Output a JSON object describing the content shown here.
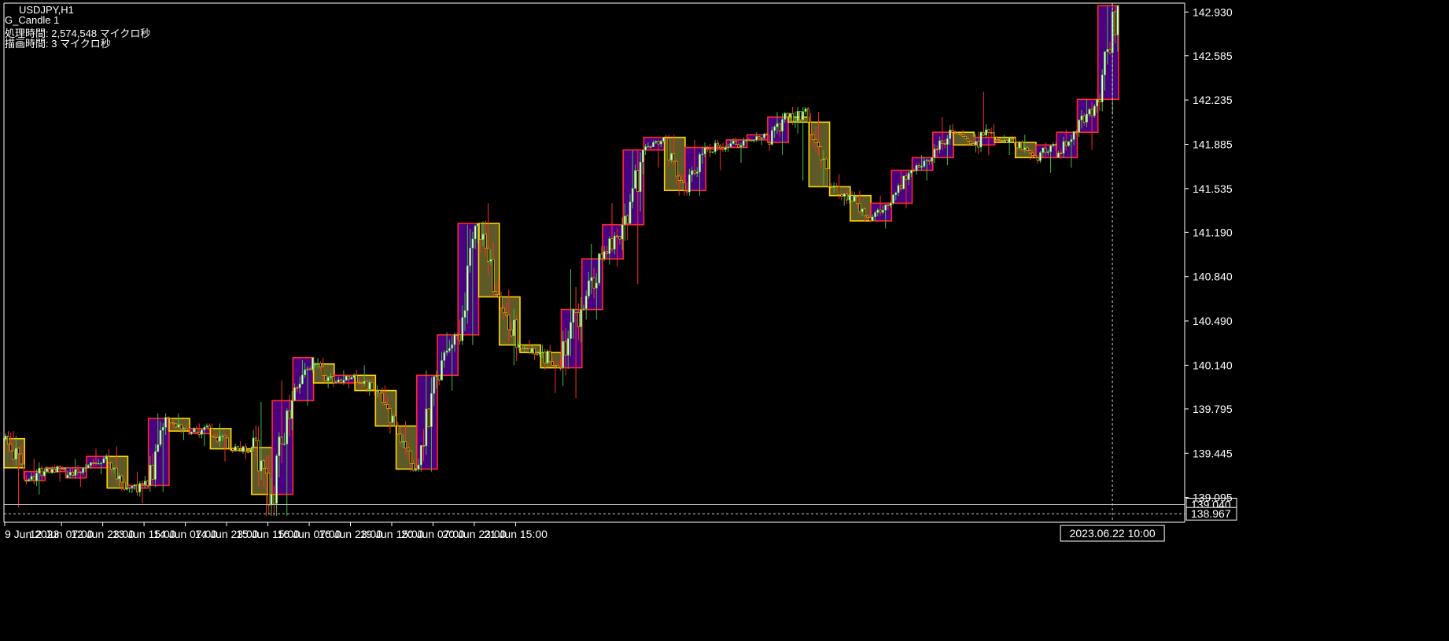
{
  "window": {
    "symbol": "USDJPY,H1",
    "indicator": "G_Candle 1",
    "info_lines": [
      "処理時間: 2,574,548 マイクロ秒",
      "描画時間: 3 マイクロ秒"
    ]
  },
  "colors": {
    "background": "#000000",
    "axis": "#ffffff",
    "bull_small_fill": "#e9ffd1",
    "bull_small_outline": "#3fbf3f",
    "bear_small_fill": "#000000",
    "bear_small_outline": "#ffd400",
    "bull_wick": "#3fbf3f",
    "bear_wick": "#ff2a2a",
    "big_bull_fill": "#4b0082",
    "big_bull_outline": "#ff2a2a",
    "big_bear_fill": "#5d5a28",
    "big_bear_outline": "#ffd400",
    "grid": "none"
  },
  "chart_data": {
    "type": "candlestick",
    "title": "USDJPY,H1",
    "timeframe_small": "H1",
    "timeframe_big": "H8",
    "ylim": [
      138.9,
      143.0
    ],
    "y_ticks": [
      "142.930",
      "142.585",
      "142.235",
      "141.885",
      "141.535",
      "141.190",
      "140.840",
      "140.490",
      "140.140",
      "139.795",
      "139.445",
      "139.095"
    ],
    "x_ticks": [
      "9 Jun 2023",
      "12 Jun 07:00",
      "12 Jun 23:00",
      "13 Jun 15:00",
      "14 Jun 07:00",
      "14 Jun 23:00",
      "15 Jun 15:00",
      "16 Jun 07:00",
      "16 Jun 23:00",
      "19 Jun 15:00",
      "20 Jun 07:00",
      "20 Jun 23:00",
      "21 Jun 15:00"
    ],
    "price_labels": [
      {
        "value": "139.040",
        "style": "dark",
        "level": 139.04
      },
      {
        "value": "138.967",
        "style": "dark",
        "level": 138.967
      }
    ],
    "crosshair": {
      "time_label": "2023.06.22 10:00",
      "bar_index": 429,
      "price": 138.967
    },
    "big_candles": [
      {
        "open": 139.56,
        "high": 139.62,
        "low": 139.02,
        "close": 139.33
      },
      {
        "open": 139.23,
        "high": 139.4,
        "low": 139.12,
        "close": 139.3
      },
      {
        "open": 139.3,
        "high": 139.35,
        "low": 139.22,
        "close": 139.33
      },
      {
        "open": 139.25,
        "high": 139.4,
        "low": 139.18,
        "close": 139.33
      },
      {
        "open": 139.33,
        "high": 139.48,
        "low": 139.28,
        "close": 139.42
      },
      {
        "open": 139.42,
        "high": 139.5,
        "low": 139.15,
        "close": 139.17
      },
      {
        "open": 139.17,
        "high": 139.3,
        "low": 139.05,
        "close": 139.19
      },
      {
        "open": 139.19,
        "high": 139.76,
        "low": 139.14,
        "close": 139.72
      },
      {
        "open": 139.72,
        "high": 139.76,
        "low": 139.55,
        "close": 139.62
      },
      {
        "open": 139.6,
        "high": 139.68,
        "low": 139.5,
        "close": 139.64
      },
      {
        "open": 139.64,
        "high": 139.68,
        "low": 139.38,
        "close": 139.48
      },
      {
        "open": 139.48,
        "high": 139.54,
        "low": 139.4,
        "close": 139.47
      },
      {
        "open": 139.49,
        "high": 139.85,
        "low": 138.95,
        "close": 139.12
      },
      {
        "open": 139.12,
        "high": 140.02,
        "low": 138.95,
        "close": 139.86
      },
      {
        "open": 139.86,
        "high": 140.18,
        "low": 139.82,
        "close": 140.2
      },
      {
        "open": 140.15,
        "high": 140.2,
        "low": 139.96,
        "close": 140.0
      },
      {
        "open": 140.0,
        "high": 140.1,
        "low": 139.96,
        "close": 140.06
      },
      {
        "open": 140.06,
        "high": 140.14,
        "low": 139.9,
        "close": 139.94
      },
      {
        "open": 139.94,
        "high": 139.98,
        "low": 139.6,
        "close": 139.66
      },
      {
        "open": 139.66,
        "high": 139.7,
        "low": 139.3,
        "close": 139.32
      },
      {
        "open": 139.32,
        "high": 140.1,
        "low": 139.3,
        "close": 140.06
      },
      {
        "open": 140.06,
        "high": 140.4,
        "low": 139.94,
        "close": 140.38
      },
      {
        "open": 140.38,
        "high": 141.25,
        "low": 140.3,
        "close": 141.26
      },
      {
        "open": 141.26,
        "high": 141.42,
        "low": 140.68,
        "close": 140.68
      },
      {
        "open": 140.68,
        "high": 140.74,
        "low": 140.14,
        "close": 140.3
      },
      {
        "open": 140.3,
        "high": 140.34,
        "low": 140.18,
        "close": 140.24
      },
      {
        "open": 140.24,
        "high": 140.3,
        "low": 139.92,
        "close": 140.12
      },
      {
        "open": 140.12,
        "high": 140.9,
        "low": 139.88,
        "close": 140.58
      },
      {
        "open": 140.58,
        "high": 141.1,
        "low": 140.5,
        "close": 140.98
      },
      {
        "open": 140.98,
        "high": 141.42,
        "low": 140.92,
        "close": 141.25
      },
      {
        "open": 141.25,
        "high": 141.84,
        "low": 140.78,
        "close": 141.84
      },
      {
        "open": 141.84,
        "high": 141.92,
        "low": 141.7,
        "close": 141.94
      },
      {
        "open": 141.94,
        "high": 141.96,
        "low": 141.48,
        "close": 141.52
      },
      {
        "open": 141.52,
        "high": 141.92,
        "low": 141.48,
        "close": 141.86
      },
      {
        "open": 141.86,
        "high": 141.92,
        "low": 141.68,
        "close": 141.86
      },
      {
        "open": 141.86,
        "high": 141.94,
        "low": 141.74,
        "close": 141.92
      },
      {
        "open": 141.92,
        "high": 141.98,
        "low": 141.88,
        "close": 141.96
      },
      {
        "open": 141.9,
        "high": 142.14,
        "low": 141.8,
        "close": 142.1
      },
      {
        "open": 142.1,
        "high": 142.18,
        "low": 141.6,
        "close": 142.06
      },
      {
        "open": 142.06,
        "high": 142.14,
        "low": 141.56,
        "close": 141.55
      },
      {
        "open": 141.55,
        "high": 141.65,
        "low": 141.4,
        "close": 141.48
      },
      {
        "open": 141.48,
        "high": 141.52,
        "low": 141.27,
        "close": 141.28
      },
      {
        "open": 141.28,
        "high": 141.48,
        "low": 141.22,
        "close": 141.42
      },
      {
        "open": 141.42,
        "high": 141.68,
        "low": 141.38,
        "close": 141.68
      },
      {
        "open": 141.68,
        "high": 141.8,
        "low": 141.6,
        "close": 141.78
      },
      {
        "open": 141.78,
        "high": 142.1,
        "low": 141.72,
        "close": 141.98
      },
      {
        "open": 141.98,
        "high": 142.0,
        "low": 141.88,
        "close": 141.88
      },
      {
        "open": 141.88,
        "high": 142.3,
        "low": 141.8,
        "close": 141.94
      },
      {
        "open": 141.94,
        "high": 141.96,
        "low": 141.8,
        "close": 141.9
      },
      {
        "open": 141.9,
        "high": 141.96,
        "low": 141.76,
        "close": 141.78
      },
      {
        "open": 141.78,
        "high": 141.9,
        "low": 141.66,
        "close": 141.88
      },
      {
        "open": 141.78,
        "high": 142.0,
        "low": 141.7,
        "close": 141.98
      },
      {
        "open": 141.98,
        "high": 142.24,
        "low": 141.84,
        "close": 142.24
      },
      {
        "open": 142.24,
        "high": 142.98,
        "low": 142.12,
        "close": 142.98
      }
    ]
  }
}
